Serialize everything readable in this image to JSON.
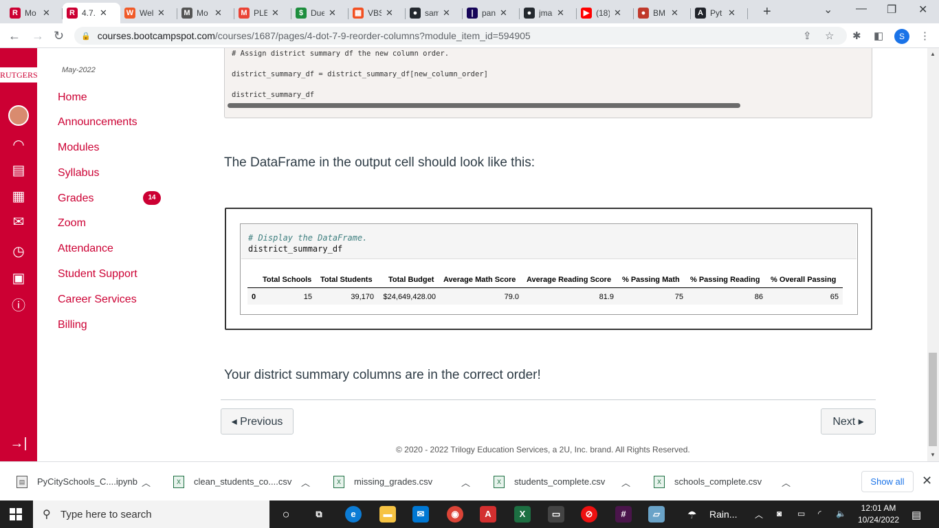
{
  "browser": {
    "tabs": [
      {
        "label": "Mo",
        "fav": "R",
        "color": "#cc0033"
      },
      {
        "label": "4.7.",
        "fav": "R",
        "color": "#cc0033",
        "active": true
      },
      {
        "label": "Wel",
        "fav": "W",
        "color": "#f05a28"
      },
      {
        "label": "Mo",
        "fav": "M",
        "color": "#555555"
      },
      {
        "label": "PLE",
        "fav": "M",
        "color": "#ea4335"
      },
      {
        "label": "Due",
        "fav": "$",
        "color": "#1e8e3e"
      },
      {
        "label": "VBS",
        "fav": "▦",
        "color": "#f25022"
      },
      {
        "label": "sam",
        "fav": "●",
        "color": "#24292f"
      },
      {
        "label": "pan",
        "fav": "|",
        "color": "#150458"
      },
      {
        "label": "jma",
        "fav": "●",
        "color": "#24292f"
      },
      {
        "label": "(18)",
        "fav": "▶",
        "color": "#ff0000"
      },
      {
        "label": "BM",
        "fav": "●",
        "color": "#c0392b"
      },
      {
        "label": "Pyt",
        "fav": "A",
        "color": "#20232a"
      }
    ],
    "url_host": "courses.bootcampspot.com",
    "url_path": "/courses/1687/pages/4-dot-7-9-reorder-columns?module_item_id=594905",
    "profile_initial": "S"
  },
  "lms": {
    "logo": "RUTGERS",
    "term": "May-2022",
    "nav": [
      "Home",
      "Announcements",
      "Modules",
      "Syllabus",
      "Grades",
      "Zoom",
      "Attendance",
      "Student Support",
      "Career Services",
      "Billing"
    ],
    "grades_badge": "14"
  },
  "content": {
    "code_lines": [
      "# Assign district summary df the new column order.",
      "district_summary_df = district_summary_df[new_column_order]",
      "district_summary_df"
    ],
    "intro": "The DataFrame in the output cell should look like this:",
    "cell_comment": "# Display the DataFrame.",
    "cell_code": "district_summary_df",
    "df_headers": [
      "Total Schools",
      "Total Students",
      "Total Budget",
      "Average Math Score",
      "Average Reading Score",
      "% Passing Math",
      "% Passing Reading",
      "% Overall Passing"
    ],
    "df_index": "0",
    "df_row": [
      "15",
      "39,170",
      "$24,649,428.00",
      "79.0",
      "81.9",
      "75",
      "86",
      "65"
    ],
    "success": "Your district summary columns are in the correct order!",
    "prev_label": "◂ Previous",
    "next_label": "Next ▸",
    "footer": "© 2020 - 2022 Trilogy Education Services, a 2U, Inc. brand. All Rights Reserved."
  },
  "downloads": {
    "items": [
      "PyCitySchools_C....ipynb",
      "clean_students_co....csv",
      "missing_grades.csv",
      "students_complete.csv",
      "schools_complete.csv"
    ],
    "show_all": "Show all"
  },
  "taskbar": {
    "search_placeholder": "Type here to search",
    "weather": "Rain...",
    "time": "12:01 AM",
    "date": "10/24/2022"
  }
}
